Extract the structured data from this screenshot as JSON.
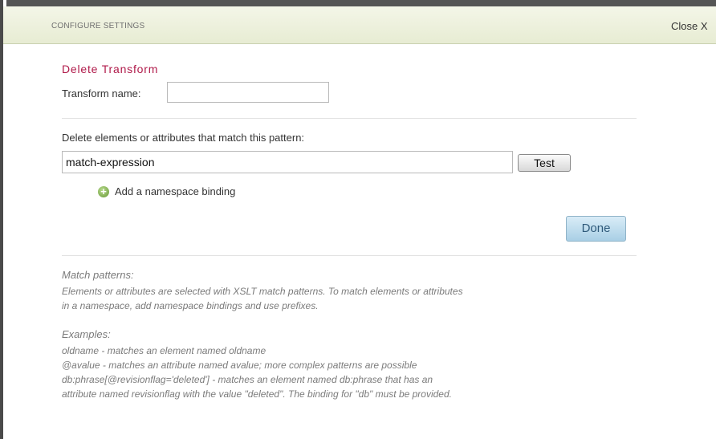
{
  "header": {
    "title": "CONFIGURE SETTINGS",
    "close_label": "Close X"
  },
  "form": {
    "section_title": "Delete Transform",
    "transform_name_label": "Transform name:",
    "transform_name_value": "",
    "pattern_label": "Delete elements or attributes that match this pattern:",
    "pattern_value": "match-expression",
    "test_label": "Test",
    "namespace_label": "Add a namespace binding",
    "done_label": "Done"
  },
  "help": {
    "match_heading": "Match patterns:",
    "match_text_1": "Elements or attributes are selected with XSLT match patterns. To match elements or attributes",
    "match_text_2": "in a namespace, add namespace bindings and use prefixes.",
    "examples_heading": "Examples:",
    "examples": [
      "oldname - matches an element named oldname",
      "@avalue - matches an attribute named avalue; more complex patterns are possible",
      "db:phrase[@revisionflag='deleted'] - matches an element named db:phrase that has an",
      "attribute named revisionflag with the value \"deleted\". The binding for \"db\" must be provided."
    ]
  },
  "colors": {
    "title": "#b01a4a",
    "header_bg": "#eef1df",
    "help_text": "#7b7b7b",
    "done_bg": "#bcdcee"
  },
  "icons": {
    "namespace_add": "plus-circle-icon"
  }
}
